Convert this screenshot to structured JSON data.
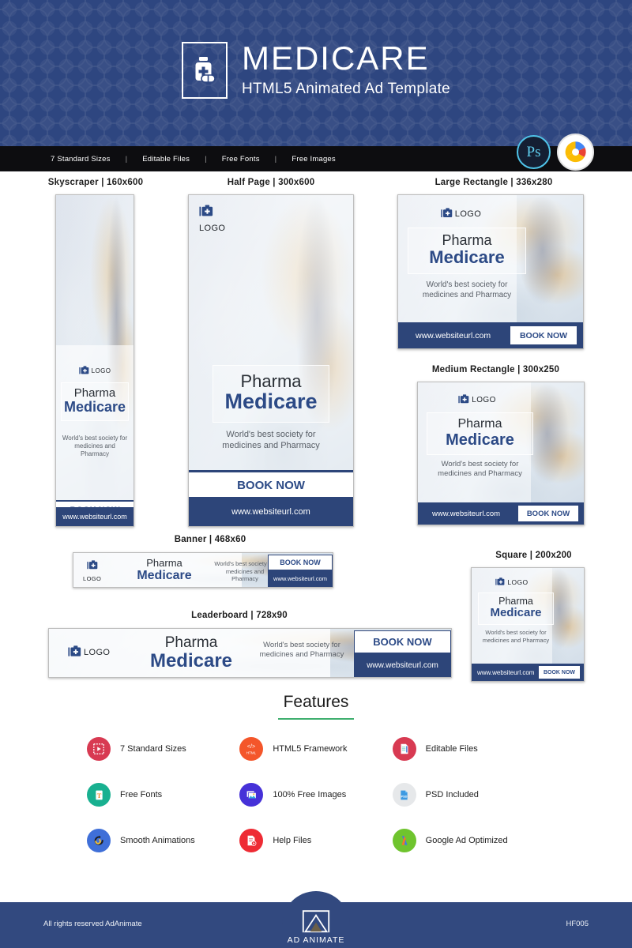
{
  "header": {
    "title": "MEDICARE",
    "subtitle": "HTML5 Animated Ad Template",
    "logo_icon": "medicine-bottle-icon"
  },
  "feature_bar": {
    "items": [
      "7 Standard Sizes",
      "Editable Files",
      "Free Fonts",
      "Free Images"
    ],
    "separator": "|",
    "badges": [
      {
        "name": "photoshop-badge",
        "label": "Ps"
      },
      {
        "name": "google-ads-badge",
        "label": ""
      }
    ]
  },
  "ad_content": {
    "logo_word": "LOGO",
    "title_line1": "Pharma",
    "title_line2": "Medicare",
    "desc_skyscraper": "World's best society for medicines and Pharmacy",
    "desc_wide": "World's best society for medicines and Pharmacy",
    "cta": "BOOK NOW",
    "url": "www.websiteurl.com"
  },
  "ads": [
    {
      "name": "skyscraper",
      "label": "Skyscraper  |  160x600"
    },
    {
      "name": "half-page",
      "label": "Half Page  |  300x600"
    },
    {
      "name": "large-rectangle",
      "label": "Large Rectangle  |  336x280"
    },
    {
      "name": "medium-rectangle",
      "label": "Medium Rectangle  |  300x250"
    },
    {
      "name": "banner",
      "label": "Banner  |  468x60"
    },
    {
      "name": "leaderboard",
      "label": "Leaderboard  |  728x90"
    },
    {
      "name": "square",
      "label": "Square  |  200x200"
    }
  ],
  "features": {
    "title": "Features",
    "accent_color": "#3fae6e",
    "items": [
      {
        "label": "7 Standard Sizes",
        "icon": "standard-sizes-icon",
        "color": "#d83a52",
        "glyph": "▣"
      },
      {
        "label": "HTML5 Framework",
        "icon": "html5-icon",
        "color": "#f4562a",
        "glyph": "‹›"
      },
      {
        "label": "Editable Files",
        "icon": "editable-files-icon",
        "color": "#d83a52",
        "glyph": "✎"
      },
      {
        "label": "Free Fonts",
        "icon": "free-fonts-icon",
        "color": "#18b090",
        "glyph": "T"
      },
      {
        "label": "100% Free Images",
        "icon": "free-images-icon",
        "color": "#4631d8",
        "glyph": "❑"
      },
      {
        "label": "PSD Included",
        "icon": "psd-included-icon",
        "color": "#e4e6e8",
        "glyph": "PSD"
      },
      {
        "label": "Smooth Animations",
        "icon": "smooth-animations-icon",
        "color": "#3f6fd8",
        "glyph": "↺"
      },
      {
        "label": "Help Files",
        "icon": "help-files-icon",
        "color": "#ee2b34",
        "glyph": "▶"
      },
      {
        "label": "Google Ad Optimized",
        "icon": "google-ad-icon",
        "color": "#6fc42e",
        "glyph": "Λ"
      }
    ]
  },
  "footer": {
    "copyright": "All rights reserved AdAnimate",
    "code": "HF005",
    "logo_name": "AD ANIMATE"
  },
  "colors": {
    "header_blue": "#2e4680",
    "accent_blue": "#2c4a86",
    "cta_blue": "#2d4579",
    "black_bar": "#0d0d10",
    "green": "#3fae6e"
  }
}
